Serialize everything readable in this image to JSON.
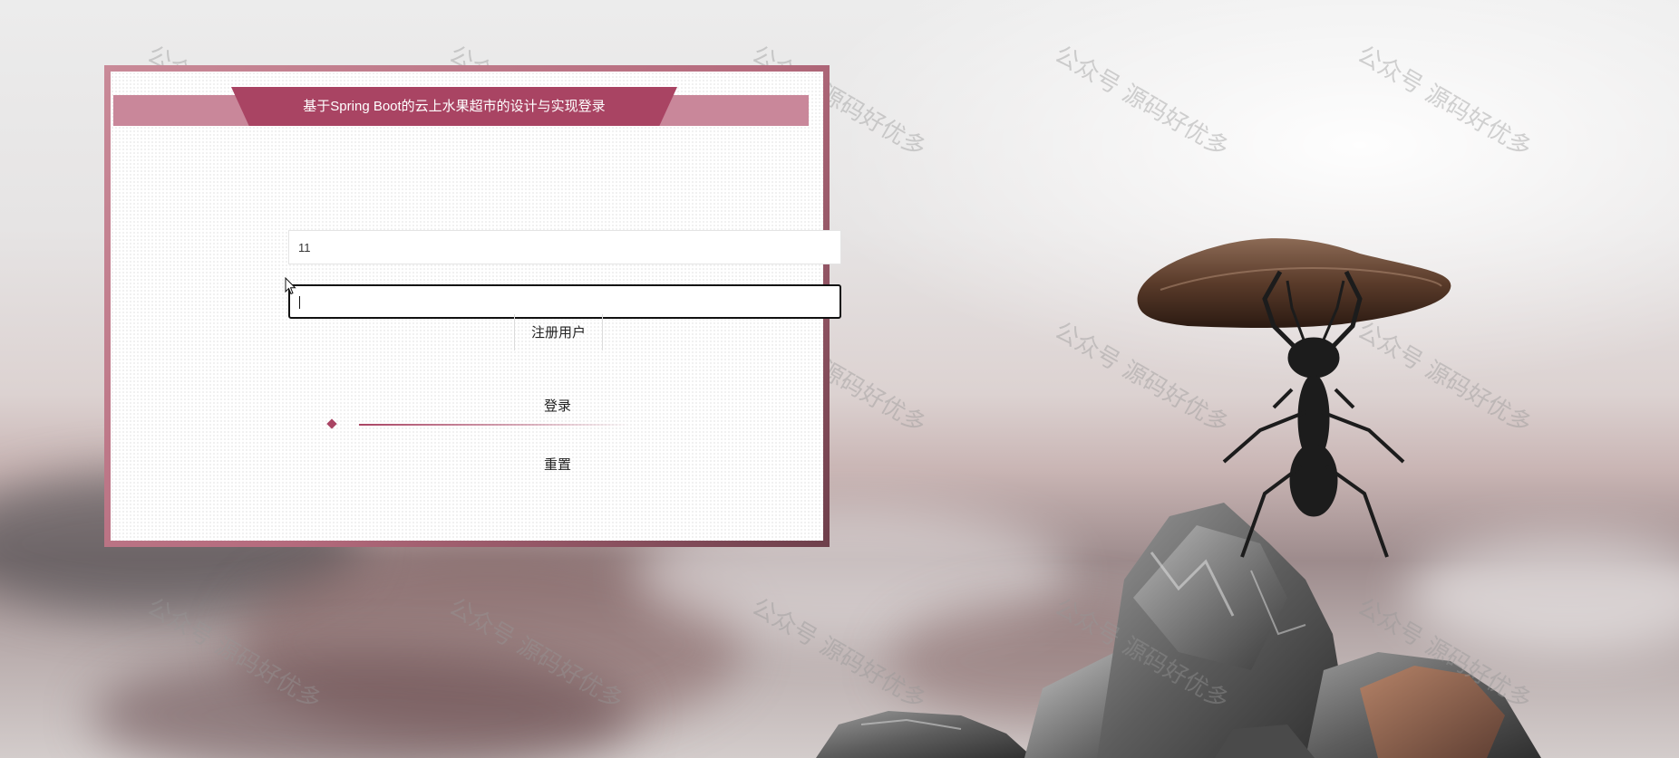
{
  "login": {
    "title": "基于Spring Boot的云上水果超市的设计与实现登录",
    "username_value": "11",
    "password_value": "",
    "register_label": "注册用户",
    "login_label": "登录",
    "reset_label": "重置"
  },
  "watermark_text": "公众号 源码好优多",
  "colors": {
    "accent": "#a94463",
    "band": "#c9879a",
    "frame_dark": "#6e3f4b"
  },
  "icons": {
    "cursor": "mouse-pointer-icon",
    "focus_marker": "diamond-icon"
  }
}
